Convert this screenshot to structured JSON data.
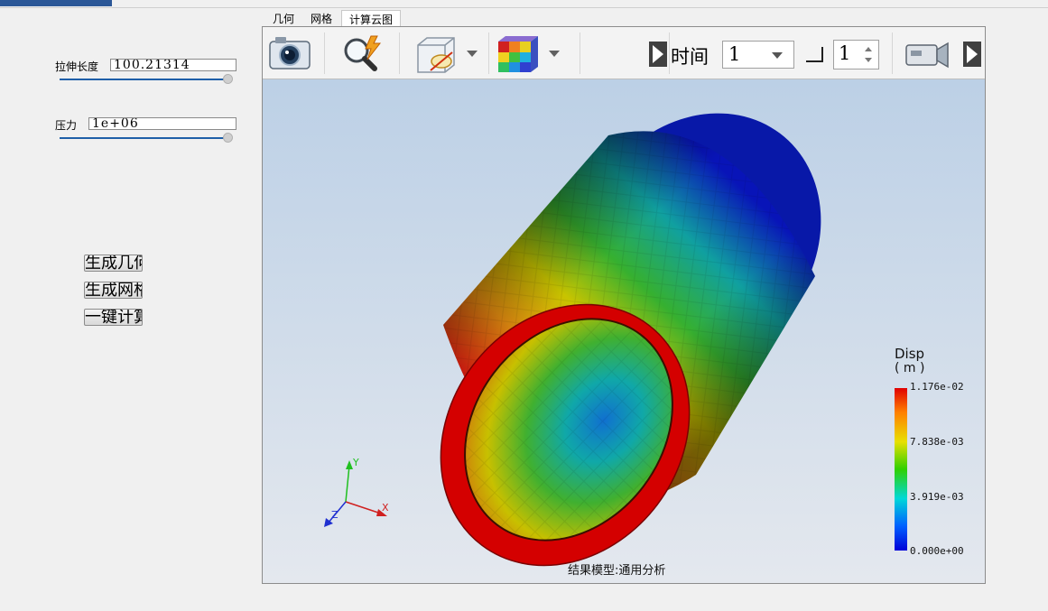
{
  "params": {
    "length_label": "拉伸长度",
    "length_value": "100.21314",
    "length_slider_fraction": 1.0,
    "pressure_label": "压力",
    "pressure_value": "1e+06",
    "pressure_slider_fraction": 1.0
  },
  "actions": {
    "gen_geometry": "生成几何",
    "gen_mesh": "生成网格",
    "one_click_compute": "一键计算"
  },
  "tabs": [
    "几何",
    "网格",
    "计算云图"
  ],
  "active_tab_index": 2,
  "toolbar": {
    "screenshot_icon": "camera-icon",
    "probe_icon": "magnifier-lightning-icon",
    "visibility_icon": "cube-hide-icon",
    "colormap_icon": "color-cube-icon",
    "time_label": "时间",
    "time_value": "1",
    "step_value": "1",
    "record_icon": "video-camera-icon"
  },
  "viewport": {
    "model_caption": "结果模型:通用分析",
    "axes": {
      "x": "X",
      "y": "Y",
      "z": "Z"
    }
  },
  "legend": {
    "title": "Disp",
    "unit": "( m )",
    "ticks": [
      "1.176e-02",
      "7.838e-03",
      "3.919e-03",
      "0.000e+00"
    ]
  },
  "colors": {
    "accent": "#2b5797",
    "slider": "#1f5fa8",
    "ring": "#d40000",
    "high": "#e00000",
    "low": "#0000d8"
  }
}
